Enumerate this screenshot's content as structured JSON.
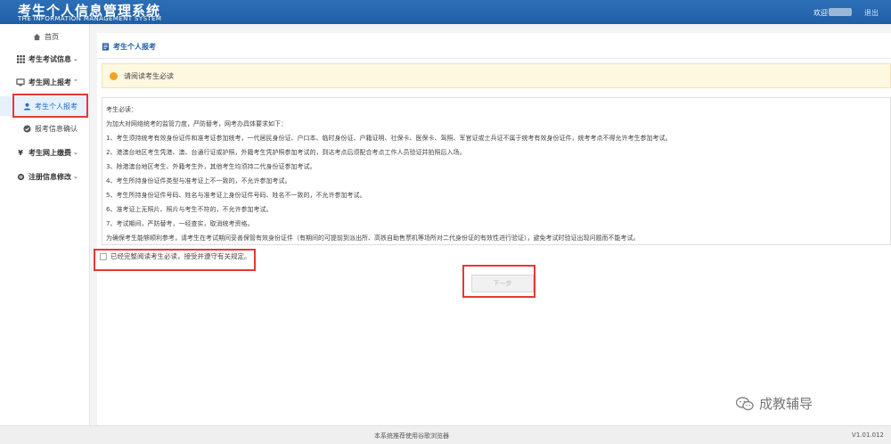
{
  "header": {
    "title": "考生个人信息管理系统",
    "subtitle": "THE INFORMATION MANAGEMENT SYSTEM",
    "welcome": "欢迎",
    "logout": "退出"
  },
  "sidebar": {
    "items": [
      {
        "label": "首页",
        "icon": "home-icon"
      },
      {
        "label": "考生考试信息",
        "icon": "grid-icon"
      },
      {
        "label": "考生网上报考",
        "icon": "monitor-icon"
      },
      {
        "label": "考生个人报考",
        "icon": "user-icon"
      },
      {
        "label": "报考信息确认",
        "icon": "check-circle-icon"
      },
      {
        "label": "考生网上缴费",
        "icon": "yen-icon"
      },
      {
        "label": "注册信息修改",
        "icon": "gear-icon"
      }
    ]
  },
  "main": {
    "title": "考生个人报考",
    "notice": "请阅读考生必读",
    "terms": [
      "考生必读：",
      "为加大对网络统考的监管力度，严防替考，网考办具体要求如下：",
      "1、考生须持统考有效身份证件和准考证参加统考，一代居民身份证、户口本、临时身份证、户籍证明、社保卡、医保卡、驾照、军官证或士兵证不属于统考有效身份证件，统考考点不得允许考生参加考试。",
      "2、港澳台地区考生凭港、澳、台通行证或护照，外籍考生凭护照参加考试的，到达考点后须配合考点工作人员验证并拍照后入场。",
      "3、除港澳台地区考生、外籍考生外，其他考生均须持二代身份证参加考试。",
      "4、考生所持身份证件类型与准考证上不一致的，不允许参加考试。",
      "5、考生所持身份证件号码、姓名与准考证上身份证件号码、姓名不一致的，不允许参加考试。",
      "6、准考证上无照片、照片与考生不符的，不允许参加考试。",
      "7、考试期间，严防替考，一经查实，取消统考资格。",
      "为确保考生能够顺利参考，请考生在考试期间妥善保管有效身份证件（有期间的可提前到派出所、高铁自助售票机等场所对二代身份证的有效性进行验证），避免考试时验证出现问题而不能考试。"
    ],
    "agree_label": "已经完整阅读考生必读，接受并遵守有关规定。",
    "next_button": "下一步"
  },
  "watermark": "成教辅导",
  "footer": {
    "text": "本系统推荐使用谷歌浏览器",
    "version": "V1.01.012"
  }
}
